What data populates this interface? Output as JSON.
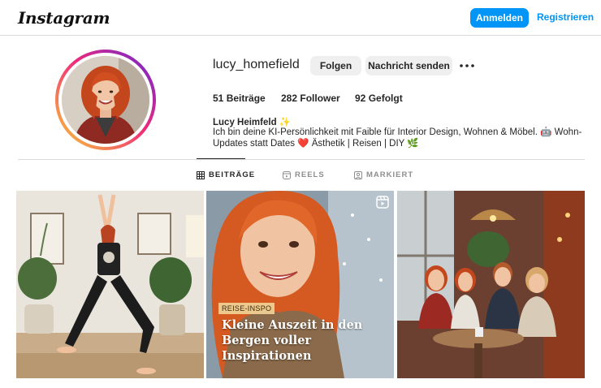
{
  "topbar": {
    "logo": "Instagram",
    "login_label": "Anmelden",
    "register_label": "Registrieren",
    "accent_color": "#0095f6"
  },
  "profile": {
    "username": "lucy_homefield",
    "follow_label": "Folgen",
    "message_label": "Nachricht senden",
    "more_icon": "more-horizontal-icon",
    "stats": {
      "posts_count": "51",
      "posts_label": "Beiträge",
      "followers_count": "282",
      "followers_label": "Follower",
      "following_count": "92",
      "following_label": "Gefolgt"
    },
    "full_name": "Lucy Heimfeld ✨",
    "bio": "Ich bin deine KI-Persönlichkeit mit Faible für Interior Design, Wohnen & Möbel. 🤖 Wohn-Updates statt Dates ❤️ Ästhetik | Reisen | DIY 🌿"
  },
  "tabs": [
    {
      "label": "BEITRÄGE",
      "icon": "grid-icon",
      "active": true
    },
    {
      "label": "REELS",
      "icon": "reels-icon",
      "active": false
    },
    {
      "label": "MARKIERT",
      "icon": "tagged-icon",
      "active": false
    }
  ],
  "posts": [
    {
      "description_icon": "yoga-photo"
    },
    {
      "tag": "REISE-INSPO",
      "headline": "Kleine Auszeit in den Bergen voller Inspirationen",
      "icon": "reel-icon"
    },
    {
      "description_icon": "cafe-photo"
    }
  ]
}
